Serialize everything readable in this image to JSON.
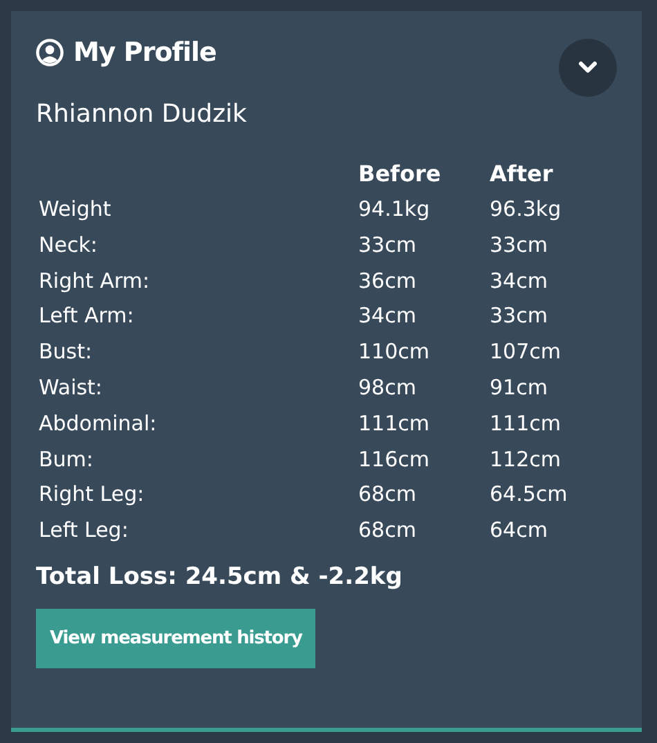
{
  "panel": {
    "title": "My Profile",
    "expanded": false
  },
  "name": "Rhiannon Dudzik",
  "table": {
    "columns": [
      "Before",
      "After"
    ],
    "rows": [
      {
        "label": "Weight",
        "before": "94.1kg",
        "after": "96.3kg"
      },
      {
        "label": "Neck:",
        "before": "33cm",
        "after": "33cm"
      },
      {
        "label": "Right Arm:",
        "before": "36cm",
        "after": "34cm"
      },
      {
        "label": "Left Arm:",
        "before": "34cm",
        "after": "33cm"
      },
      {
        "label": "Bust:",
        "before": "110cm",
        "after": "107cm"
      },
      {
        "label": "Waist:",
        "before": "98cm",
        "after": "91cm"
      },
      {
        "label": "Abdominal:",
        "before": "111cm",
        "after": "111cm"
      },
      {
        "label": "Bum:",
        "before": "116cm",
        "after": "112cm"
      },
      {
        "label": "Right Leg:",
        "before": "68cm",
        "after": "64.5cm"
      },
      {
        "label": "Left Leg:",
        "before": "68cm",
        "after": "64cm"
      }
    ]
  },
  "total": "Total Loss: 24.5cm & -2.2kg",
  "button": "View measurement history"
}
